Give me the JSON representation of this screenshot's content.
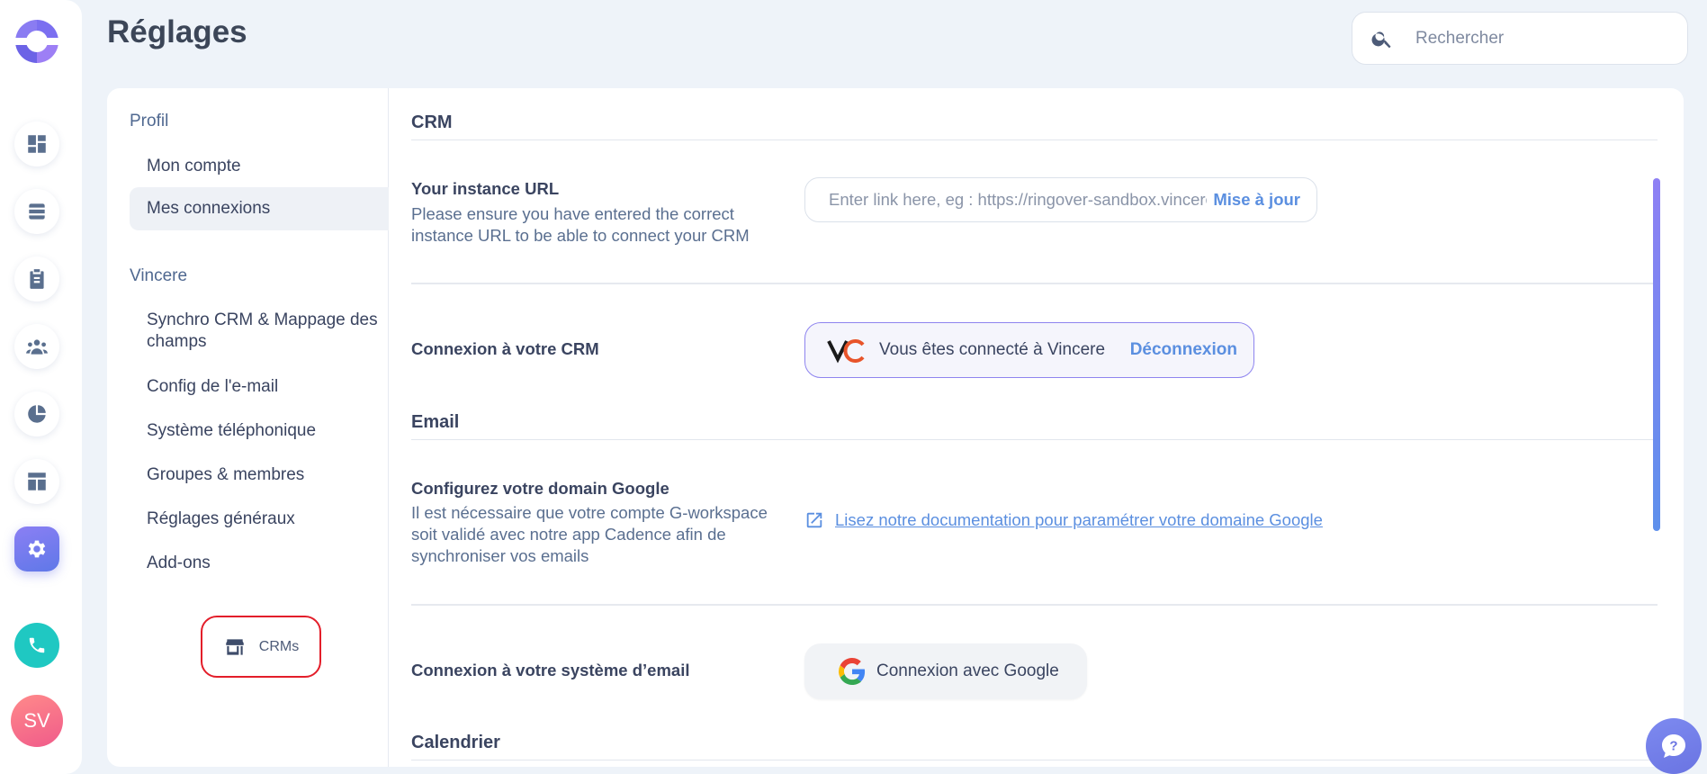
{
  "app": {
    "avatar_initials": "SV"
  },
  "header": {
    "title": "Réglages",
    "search_placeholder": "Rechercher"
  },
  "sidebar": {
    "section_profile": "Profil",
    "profile_items": [
      "Mon compte",
      "Mes connexions"
    ],
    "section_vincere": "Vincere",
    "vincere_items": [
      "Synchro CRM & Mappage des champs",
      "Config de l'e-mail",
      "Système téléphonique",
      "Groupes & membres",
      "Réglages généraux",
      "Add-ons"
    ],
    "crm_tab_label": "CRMs"
  },
  "content": {
    "crm_section_title": "CRM",
    "instance_url": {
      "label": "Your instance URL",
      "description": "Please ensure you have entered the correct instance URL to be able to connect your CRM",
      "placeholder": "Enter link here, eg : https://ringover-sandbox.vincere.io",
      "button_label": "Mise à jour"
    },
    "crm_connection": {
      "label": "Connexion à votre CRM",
      "status_text": "Vous êtes connecté à Vincere",
      "disconnect_label": "Déconnexion"
    },
    "email_section_title": "Email",
    "google_domain": {
      "label": "Configurez votre domain Google",
      "description": "Il est nécessaire que votre compte G-workspace soit validé avec notre app Cadence afin de synchroniser vos emails",
      "doc_link": "Lisez notre documentation pour paramétrer votre domaine Google"
    },
    "email_system": {
      "label": "Connexion à votre système d’email",
      "button_label": "Connexion avec Google"
    },
    "calendar_section_title": "Calendrier"
  },
  "colors": {
    "accent": "#5b8fe0",
    "active_nav": "#7b7ff0",
    "phone": "#1fc8c2",
    "highlight_border": "#e31e2a"
  }
}
